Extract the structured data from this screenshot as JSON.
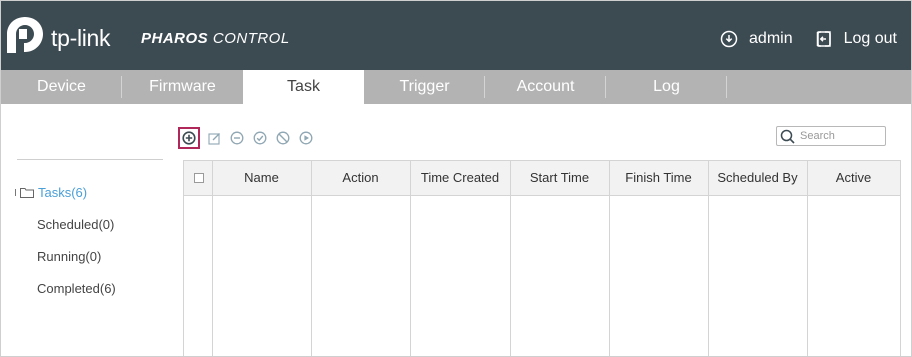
{
  "header": {
    "brand": "tp-link",
    "product_bold": "PHAROS",
    "product_light": " CONTROL",
    "user": "admin",
    "logout": "Log out"
  },
  "tabs": [
    "Device",
    "Firmware",
    "Task",
    "Trigger",
    "Account",
    "Log"
  ],
  "active_tab": "Task",
  "sidebar": {
    "root": "Tasks(6)",
    "children": [
      "Scheduled(0)",
      "Running(0)",
      "Completed(6)"
    ]
  },
  "toolbar": {
    "icons": [
      "add-icon",
      "edit-icon",
      "remove-icon",
      "enable-icon",
      "disable-icon",
      "run-icon"
    ]
  },
  "search": {
    "placeholder": "Search",
    "value": ""
  },
  "table": {
    "columns": [
      "Name",
      "Action",
      "Time Created",
      "Start Time",
      "Finish Time",
      "Scheduled By",
      "Active"
    ],
    "rows": []
  },
  "colors": {
    "header_bg": "#3c4a52",
    "tab_bar_bg": "#b3b3b3",
    "accent_link": "#4a9fd8",
    "highlight_border": "#b0285a"
  }
}
